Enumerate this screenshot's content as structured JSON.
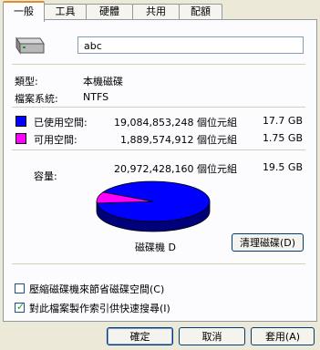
{
  "tabs": [
    "一般",
    "工具",
    "硬體",
    "共用",
    "配額"
  ],
  "drive": {
    "name_value": "abc",
    "type_label": "類型:",
    "type_value": "本機磁碟",
    "fs_label": "檔案系統:",
    "fs_value": "NTFS"
  },
  "space": {
    "used_label": "已使用空間:",
    "used_bytes": "19,084,853,248 個位元組",
    "used_gb": "17.7 GB",
    "free_label": "可用空間:",
    "free_bytes": "1,889,574,912 個位元組",
    "free_gb": "1.75 GB",
    "capacity_label": "容量:",
    "capacity_bytes": "20,972,428,160 個位元組",
    "capacity_gb": "19.5 GB",
    "used_color": "#0000ff",
    "free_color": "#ff00ff",
    "used_fraction": 0.91
  },
  "disk_label": "磁碟機 D",
  "cleanup_button": "清理磁碟(D)",
  "options": {
    "compress": {
      "label": "壓縮磁碟機來節省磁碟空間(C)",
      "checked": false
    },
    "index": {
      "label": "對此檔案製作索引供快速搜尋(I)",
      "checked": true
    }
  },
  "buttons": {
    "ok": "確定",
    "cancel": "取消",
    "apply": "套用(A)"
  }
}
